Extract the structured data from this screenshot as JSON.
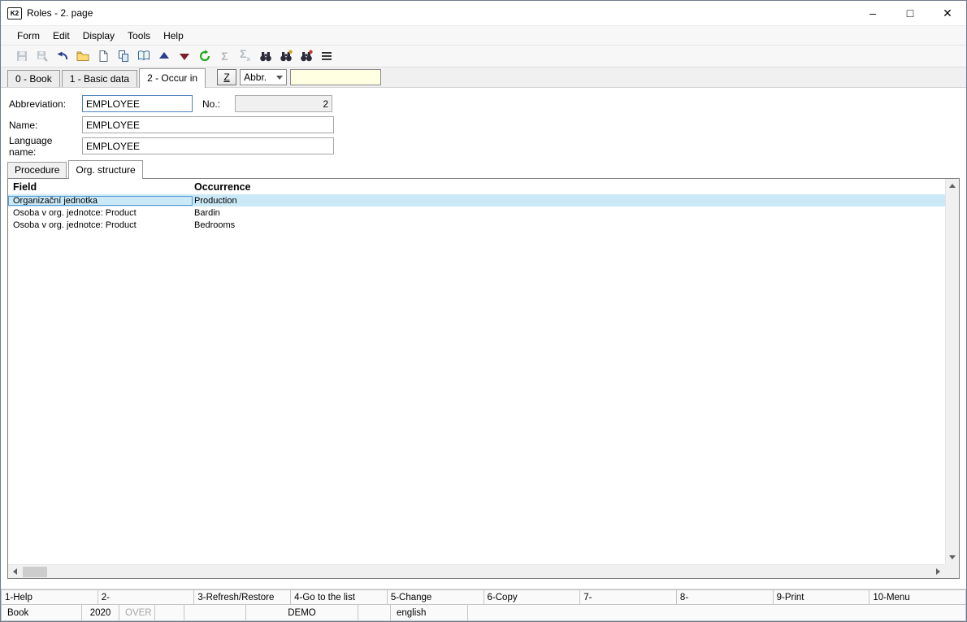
{
  "window": {
    "title": "Roles - 2. page",
    "icon_text": "K2",
    "controls": {
      "minimize": "–",
      "maximize": "□",
      "close": "✕"
    }
  },
  "menu": {
    "items": [
      "Form",
      "Edit",
      "Display",
      "Tools",
      "Help"
    ]
  },
  "toolbar": {
    "icons": [
      "save-icon",
      "save-record-icon",
      "undo-icon",
      "open-icon",
      "new-icon",
      "copy-icon",
      "book-icon",
      "up-arrow-icon",
      "down-arrow-icon",
      "refresh-green-icon",
      "sum-icon",
      "sum-filter-icon",
      "find-icon",
      "find-next-icon",
      "find-selection-icon",
      "list-icon"
    ]
  },
  "page_tabs": {
    "tabs": [
      {
        "label": "0 - Book",
        "active": false
      },
      {
        "label": "1 - Basic data",
        "active": false
      },
      {
        "label": "2 - Occur in",
        "active": true
      }
    ]
  },
  "quick_filter": {
    "z_button": "Z",
    "field_selector": "Abbr.",
    "value": ""
  },
  "form": {
    "abbreviation_label": "Abbreviation:",
    "abbreviation_value": "EMPLOYEE",
    "no_label": "No.:",
    "no_value": "2",
    "name_label": "Name:",
    "name_value": "EMPLOYEE",
    "language_label": "Language name:",
    "language_value": "EMPLOYEE"
  },
  "detail_tabs": {
    "tabs": [
      {
        "label": "Procedure",
        "active": false
      },
      {
        "label": "Org. structure",
        "active": true
      }
    ]
  },
  "grid": {
    "columns": [
      "Field",
      "Occurrence"
    ],
    "rows": [
      {
        "field": "Organizační jednotka",
        "occurrence": "Production",
        "selected": true
      },
      {
        "field": "Osoba v org. jednotce: Product",
        "occurrence": "Bardin",
        "selected": false
      },
      {
        "field": "Osoba v org. jednotce: Product",
        "occurrence": "Bedrooms",
        "selected": false
      }
    ]
  },
  "function_bar": {
    "keys": [
      "1-Help",
      "2-",
      "3-Refresh/Restore",
      "4-Go to the list",
      "5-Change",
      "6-Copy",
      "7-",
      "8-",
      "9-Print",
      "10-Menu"
    ]
  },
  "status_bar": {
    "book": "Book",
    "year": "2020",
    "mode": "OVER",
    "company": "DEMO",
    "language": "english"
  }
}
